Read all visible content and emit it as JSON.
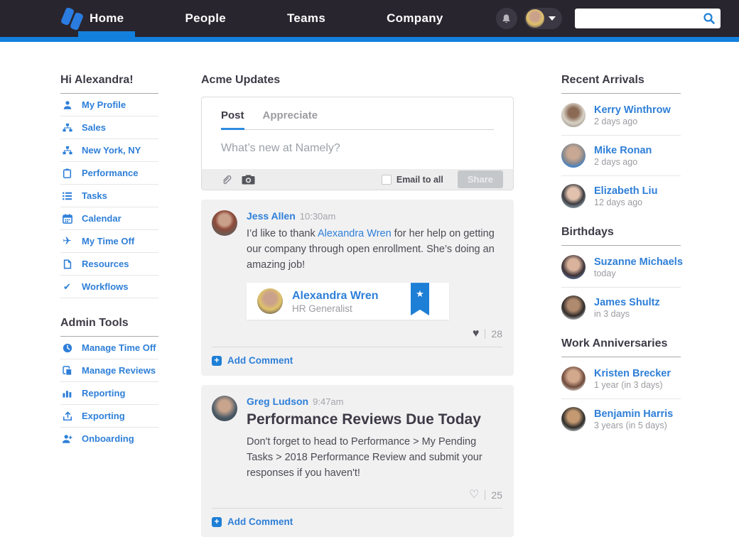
{
  "colors": {
    "brand_blue": "#1380dd",
    "link_blue": "#2e7fd8",
    "navbar_bg": "#29252e",
    "post_bg": "#f1f1f2"
  },
  "navbar": {
    "items": [
      {
        "label": "Home",
        "active": true
      },
      {
        "label": "People",
        "active": false
      },
      {
        "label": "Teams",
        "active": false
      },
      {
        "label": "Company",
        "active": false
      }
    ],
    "search": {
      "value": "",
      "placeholder": ""
    }
  },
  "sidebar": {
    "greeting": "Hi Alexandra!",
    "items": [
      {
        "icon": "person-icon",
        "label": "My Profile"
      },
      {
        "icon": "org-chart-icon",
        "label": "Sales"
      },
      {
        "icon": "org-chart-icon",
        "label": "New York, NY"
      },
      {
        "icon": "clipboard-icon",
        "label": "Performance"
      },
      {
        "icon": "list-icon",
        "label": "Tasks"
      },
      {
        "icon": "calendar-icon",
        "label": "Calendar"
      },
      {
        "icon": "plane-icon",
        "label": "My Time Off"
      },
      {
        "icon": "document-icon",
        "label": "Resources"
      },
      {
        "icon": "check-icon",
        "label": "Workflows"
      }
    ],
    "admin_heading": "Admin Tools",
    "admin_items": [
      {
        "icon": "clock-icon",
        "label": "Manage Time Off"
      },
      {
        "icon": "copy-icon",
        "label": "Manage Reviews"
      },
      {
        "icon": "bar-chart-icon",
        "label": "Reporting"
      },
      {
        "icon": "export-icon",
        "label": "Exporting"
      },
      {
        "icon": "person-plus-icon",
        "label": "Onboarding"
      }
    ]
  },
  "feed": {
    "title": "Acme Updates",
    "composer": {
      "tab_post": "Post",
      "tab_appreciate": "Appreciate",
      "placeholder": "What’s new at Namely?",
      "email_label": "Email to all",
      "share_label": "Share"
    },
    "posts": [
      {
        "author": "Jess Allen",
        "time": "10:30am",
        "body_prefix": "I’d like to thank ",
        "body_link": "Alexandra Wren",
        "body_suffix": " for her help on getting our company through open enrollment. She’s doing an amazing job!",
        "card": {
          "name": "Alexandra Wren",
          "role": "HR Generalist"
        },
        "likes": "28",
        "add_comment": "Add Comment"
      },
      {
        "author": "Greg Ludson",
        "time": "9:47am",
        "title": "Performance Reviews Due Today",
        "body": "Don't forget to head to Performance > My Pending Tasks > 2018 Performance Review and submit your responses if you haven't!",
        "likes": "25",
        "add_comment": "Add Comment"
      }
    ]
  },
  "right_rail": {
    "sections": [
      {
        "heading": "Recent Arrivals",
        "people": [
          {
            "name": "Kerry Winthrow",
            "sub": "2 days ago"
          },
          {
            "name": "Mike Ronan",
            "sub": "2 days ago"
          },
          {
            "name": "Elizabeth Liu",
            "sub": "12 days ago"
          }
        ]
      },
      {
        "heading": "Birthdays",
        "people": [
          {
            "name": "Suzanne Michaels",
            "sub": "today"
          },
          {
            "name": "James Shultz",
            "sub": "in 3 days"
          }
        ]
      },
      {
        "heading": "Work Anniversaries",
        "people": [
          {
            "name": "Kristen Brecker",
            "sub": "1 year (in 3 days)"
          },
          {
            "name": "Benjamin Harris",
            "sub": "3 years (in 5 days)"
          }
        ]
      }
    ]
  }
}
